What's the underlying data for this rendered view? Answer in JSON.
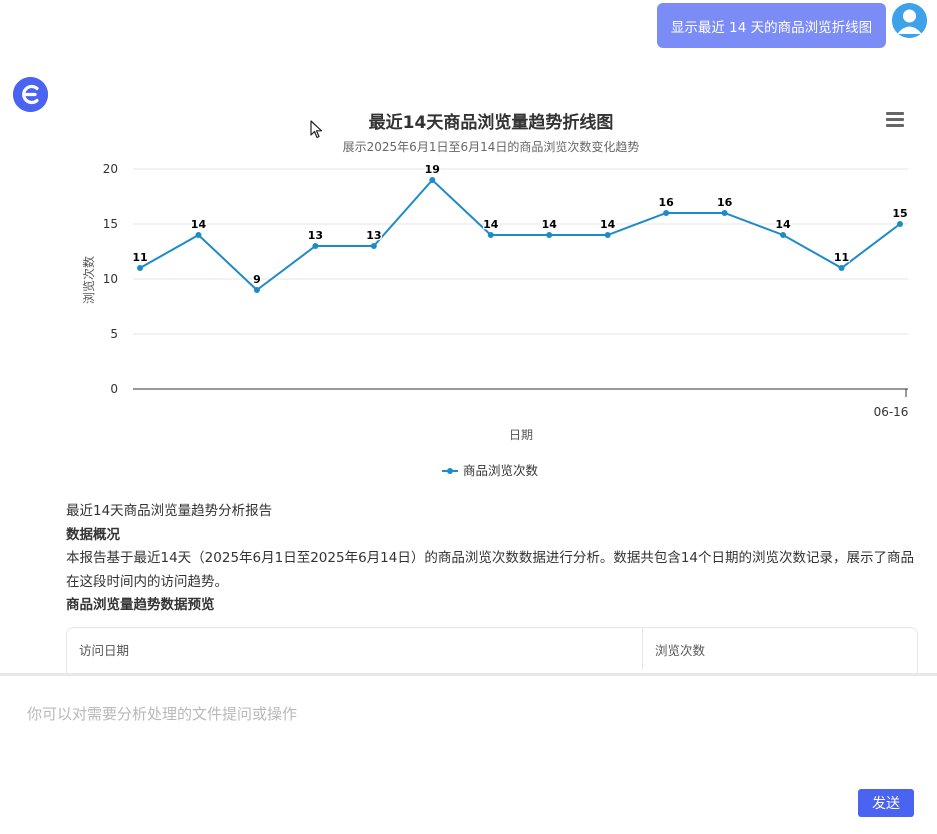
{
  "user_message": "显示最近 14 天的商品浏览折线图",
  "chart_data": {
    "type": "line",
    "title": "最近14天商品浏览量趋势折线图",
    "subtitle": "展示2025年6月1日至6月14日的商品浏览次数变化趋势",
    "xlabel": "日期",
    "ylabel": "浏览次数",
    "ylim": [
      0,
      20
    ],
    "yticks": [
      0,
      5,
      10,
      15,
      20
    ],
    "x_tick_labels": [
      "06-16"
    ],
    "series": [
      {
        "name": "商品浏览次数",
        "values": [
          11,
          14,
          9,
          13,
          13,
          19,
          14,
          14,
          14,
          16,
          16,
          14,
          11,
          15
        ]
      }
    ],
    "grid": true,
    "legend": "bottom-center",
    "line_color": "#1c8bc7"
  },
  "report": {
    "title": "最近14天商品浏览量趋势分析报告",
    "section1_heading": "数据概况",
    "section1_text": "本报告基于最近14天（2025年6月1日至2025年6月14日）的商品浏览次数数据进行分析。数据共包含14个日期的浏览次数记录，展示了商品在这段时间内的访问趋势。",
    "section2_heading": "商品浏览量趋势数据预览"
  },
  "table": {
    "columns": [
      "访问日期",
      "浏览次数"
    ]
  },
  "input": {
    "placeholder": "你可以对需要分析处理的文件提问或操作",
    "send_label": "发送"
  },
  "icons": {
    "user_avatar": "user-icon",
    "bot_avatar": "e-logo-icon",
    "chart_menu": "hamburger-menu-icon",
    "cursor": "mouse-pointer-icon"
  },
  "colors": {
    "accent": "#4a63f0",
    "bubble": "#7b8cf6",
    "avatar": "#3ea2ea"
  }
}
